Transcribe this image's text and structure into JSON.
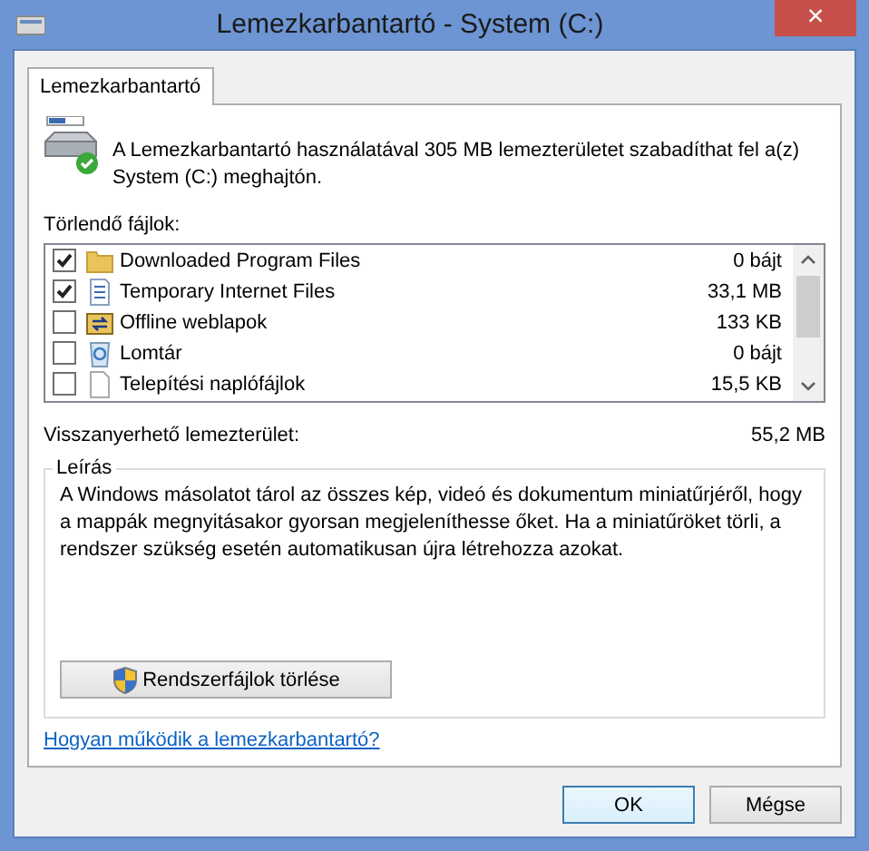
{
  "window": {
    "title": "Lemezkarbantartó - System (C:)",
    "close": "×"
  },
  "tabs": [
    {
      "label": "Lemezkarbantartó",
      "selected": true
    }
  ],
  "intro": "A Lemezkarbantartó használatával 305 MB lemezterületet szabadíthat fel a(z) System (C:) meghajtón.",
  "files_label": "Törlendő fájlok:",
  "files": [
    {
      "name": "Downloaded Program Files",
      "size": "0 bájt",
      "checked": true
    },
    {
      "name": "Temporary Internet Files",
      "size": "33,1 MB",
      "checked": true
    },
    {
      "name": "Offline weblapok",
      "size": "133 KB",
      "checked": false
    },
    {
      "name": "Lomtár",
      "size": "0 bájt",
      "checked": false
    },
    {
      "name": "Telepítési naplófájlok",
      "size": "15,5 KB",
      "checked": false
    }
  ],
  "recoverable": {
    "label": "Visszanyerhető lemezterület:",
    "value": "55,2 MB"
  },
  "description": {
    "title": "Leírás",
    "text": "A Windows másolatot tárol az összes kép, videó és dokumentum miniatűrjéről, hogy a mappák megnyitásakor gyorsan megjeleníthesse őket. Ha a miniatűröket törli, a rendszer szükség esetén automatikusan újra létrehozza azokat.",
    "button": "Rendszerfájlok törlése"
  },
  "help_link": "Hogyan működik a lemezkarbantartó?",
  "buttons": [
    "OK",
    "Mégse"
  ]
}
